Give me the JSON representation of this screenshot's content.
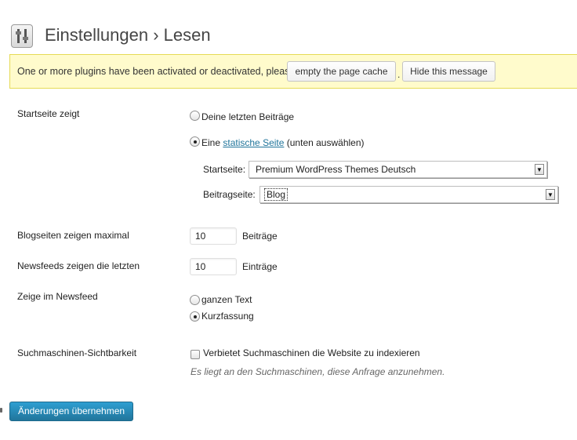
{
  "header": {
    "title": "Einstellungen › Lesen",
    "icon": "settings-sliders-icon"
  },
  "notice": {
    "text": "One or more plugins have been activated or deactivated, please",
    "cache_button": "empty the page cache",
    "separator": ".",
    "hide_button": "Hide this message"
  },
  "front_page": {
    "label": "Startseite zeigt",
    "option_latest": "Deine letzten Beiträge",
    "option_static_prefix": "Eine",
    "option_static_link": "statische Seite",
    "option_static_suffix": "(unten auswählen)",
    "selected": "static",
    "startseite_label": "Startseite:",
    "startseite_value": "Premium WordPress Themes Deutsch",
    "beitragseite_label": "Beitragseite:",
    "beitragseite_value": "Blog"
  },
  "blog_pages": {
    "label": "Blogseiten zeigen maximal",
    "value": "10",
    "unit": "Beiträge"
  },
  "feeds": {
    "label": "Newsfeeds zeigen die letzten",
    "value": "10",
    "unit": "Einträge"
  },
  "feed_content": {
    "label": "Zeige im Newsfeed",
    "option_full": "ganzen Text",
    "option_summary": "Kurzfassung",
    "selected": "summary"
  },
  "search_visibility": {
    "label": "Suchmaschinen-Sichtbarkeit",
    "checkbox_label": "Verbietet Suchmaschinen die Website zu indexieren",
    "checked": false,
    "hint": "Es liegt an den Suchmaschinen, diese Anfrage anzunehmen."
  },
  "submit": {
    "label": "Änderungen übernehmen"
  },
  "colors": {
    "notice_bg": "#fffbcc",
    "primary": "#21759b",
    "link": "#21759b"
  }
}
